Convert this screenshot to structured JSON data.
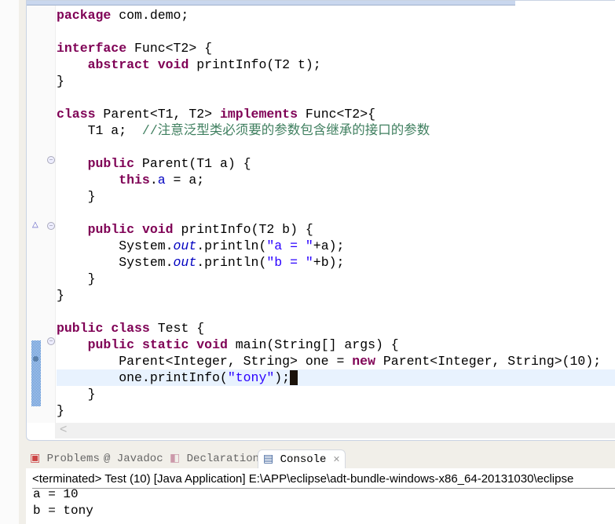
{
  "editor": {
    "lines": [
      [
        [
          "kw",
          "package"
        ],
        [
          "p",
          " com.demo;"
        ]
      ],
      [],
      [
        [
          "kw",
          "interface"
        ],
        [
          "p",
          " Func<T2> {"
        ]
      ],
      [
        [
          "p",
          "    "
        ],
        [
          "kw",
          "abstract"
        ],
        [
          "p",
          " "
        ],
        [
          "kw",
          "void"
        ],
        [
          "p",
          " printInfo(T2 t);"
        ]
      ],
      [
        [
          "p",
          "}"
        ]
      ],
      [],
      [
        [
          "kw",
          "class"
        ],
        [
          "p",
          " Parent<T1, T2> "
        ],
        [
          "kw",
          "implements"
        ],
        [
          "p",
          " Func<T2>{"
        ]
      ],
      [
        [
          "p",
          "    T1 a;  "
        ],
        [
          "cm",
          "//注意泛型类必须要的参数包含继承的接口的参数"
        ]
      ],
      [],
      [
        [
          "p",
          "    "
        ],
        [
          "kw",
          "public"
        ],
        [
          "p",
          " Parent(T1 a) {"
        ]
      ],
      [
        [
          "p",
          "        "
        ],
        [
          "kw",
          "this"
        ],
        [
          "p",
          "."
        ],
        [
          "fld",
          "a"
        ],
        [
          "p",
          " = a;"
        ]
      ],
      [
        [
          "p",
          "    }"
        ]
      ],
      [],
      [
        [
          "p",
          "    "
        ],
        [
          "kw",
          "public"
        ],
        [
          "p",
          " "
        ],
        [
          "kw",
          "void"
        ],
        [
          "p",
          " printInfo(T2 b) {"
        ]
      ],
      [
        [
          "p",
          "        System."
        ],
        [
          "sfld",
          "out"
        ],
        [
          "p",
          ".println("
        ],
        [
          "str",
          "\"a = \""
        ],
        [
          "p",
          "+a);"
        ]
      ],
      [
        [
          "p",
          "        System."
        ],
        [
          "sfld",
          "out"
        ],
        [
          "p",
          ".println("
        ],
        [
          "str",
          "\"b = \""
        ],
        [
          "p",
          "+b);"
        ]
      ],
      [
        [
          "p",
          "    }"
        ]
      ],
      [
        [
          "p",
          "}"
        ]
      ],
      [],
      [
        [
          "kw",
          "public"
        ],
        [
          "p",
          " "
        ],
        [
          "kw",
          "class"
        ],
        [
          "p",
          " Test {"
        ]
      ],
      [
        [
          "p",
          "    "
        ],
        [
          "kw",
          "public"
        ],
        [
          "p",
          " "
        ],
        [
          "kw",
          "static"
        ],
        [
          "p",
          " "
        ],
        [
          "kw",
          "void"
        ],
        [
          "p",
          " main(String[] args) {"
        ]
      ],
      [
        [
          "p",
          "        Parent<Integer, String> one = "
        ],
        [
          "kw",
          "new"
        ],
        [
          "p",
          " Parent<Integer, String>(10);"
        ]
      ],
      [
        [
          "p",
          "        one.printInfo("
        ],
        [
          "str",
          "\"tony\""
        ],
        [
          "p",
          ");"
        ]
      ],
      [
        [
          "p",
          "    }"
        ]
      ],
      [
        [
          "p",
          "}"
        ]
      ]
    ],
    "current_line": 23
  },
  "panel": {
    "tabs": [
      {
        "label": "Problems",
        "icon": "problems-icon"
      },
      {
        "label": "@ Javadoc",
        "icon": "javadoc-icon"
      },
      {
        "label": "Declaration",
        "icon": "declaration-icon"
      },
      {
        "label": "Console",
        "icon": "console-icon",
        "active": true
      }
    ],
    "console_header": "<terminated> Test (10) [Java Application] E:\\APP\\eclipse\\adt-bundle-windows-x86_64-20131030\\eclipse",
    "output": [
      "a = 10",
      "b = tony"
    ]
  }
}
